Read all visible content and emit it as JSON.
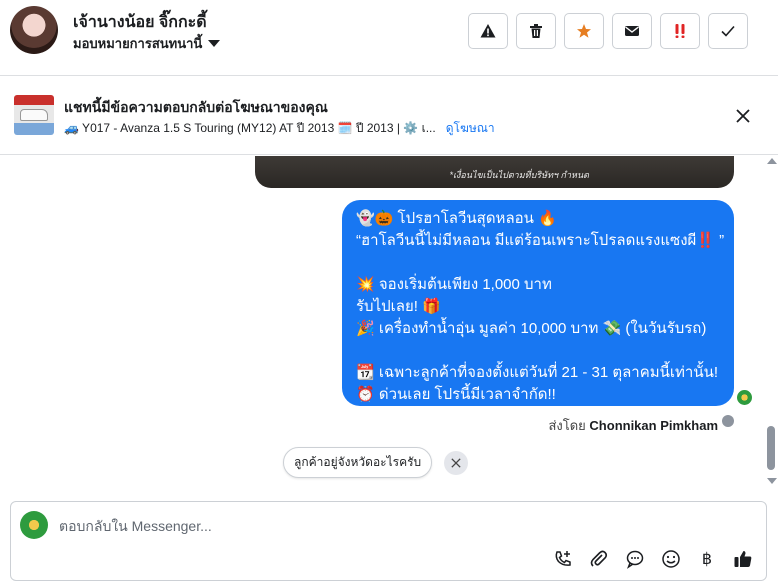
{
  "header": {
    "contact_name": "เจ้านางน้อย จิ๊กกะดี้",
    "assign_label": "มอบหมายการสนทนานี้",
    "actions": [
      {
        "name": "report-spam-button",
        "icon": "warning-icon",
        "color": "#1c1e21"
      },
      {
        "name": "delete-button",
        "icon": "trash-icon",
        "color": "#1c1e21"
      },
      {
        "name": "star-button",
        "icon": "star-icon",
        "color": "#e67e22"
      },
      {
        "name": "mark-unread-button",
        "icon": "envelope-icon",
        "color": "#1c1e21"
      },
      {
        "name": "follow-up-button",
        "icon": "double-exclamation-icon",
        "color": "#e02424"
      },
      {
        "name": "mark-done-button",
        "icon": "checkmark-icon",
        "color": "#1c1e21"
      }
    ]
  },
  "ad": {
    "title": "แชทนี้มีข้อความตอบกลับต่อโฆษณาของคุณ",
    "subtitle": "🚙 Y017 - Avanza 1.5 S Touring (MY12) AT ปี 2013 🗓️ ปี 2013 | ⚙️ เ...",
    "link": "ดูโฆษณา"
  },
  "chat": {
    "image_caption": "*เงื่อนไขเป็นไปตามที่บริษัทฯ กำหนด",
    "message_lines": [
      "👻🎃 โปรฮาโลวีนสุดหลอน 🔥",
      "“ฮาโลวีนนี้ไม่มีหลอน มีแต่ร้อนเพราะโปรลดแรงแซงผี‼️ ”",
      "",
      "💥 จองเริ่มต้นเพียง 1,000 บาท",
      "รับไปเลย! 🎁",
      "🎉 เครื่องทำน้ำอุ่น มูลค่า 10,000 บาท 💸 (ในวันรับรถ)",
      "",
      "📆 เฉพาะลูกค้าที่จองตั้งแต่วันที่ 21 - 31 ตุลาคมนี้เท่านั้น!",
      "⏰ ด่วนเลย โปรนี้มีเวลาจำกัด!!"
    ],
    "sent_by_prefix": "ส่งโดย",
    "sent_by_name": "Chonnikan Pimkham",
    "suggestion_chip": "ลูกค้าอยู่จังหวัดอะไรครับ"
  },
  "composer": {
    "placeholder": "ตอบกลับใน Messenger...",
    "currency_symbol": "฿"
  },
  "colors": {
    "accent": "#1877f2",
    "star": "#e67e22",
    "alert": "#e02424"
  }
}
